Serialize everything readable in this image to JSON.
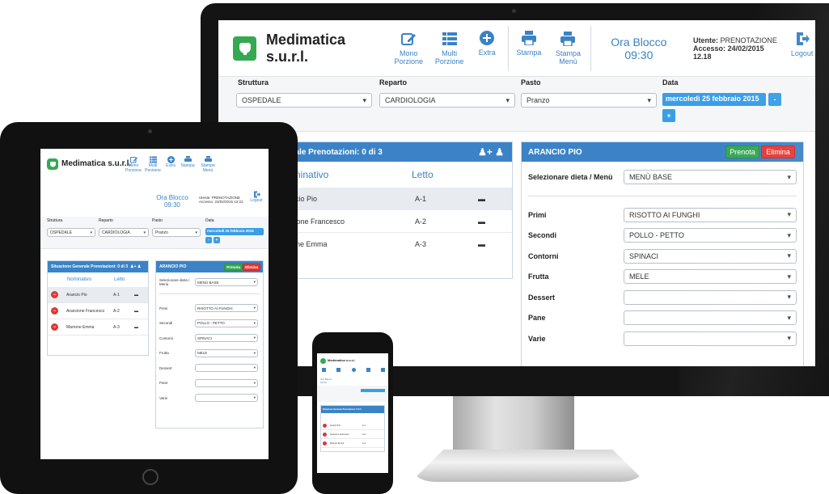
{
  "app": {
    "brand": "Medimatica s.u.r.l.",
    "toolbar": {
      "mono": [
        "Mono",
        "Porzione"
      ],
      "multi": [
        "Multi",
        "Porzione"
      ],
      "extra": "Extra",
      "stampa": "Stampa",
      "stampa_menu": [
        "Stampa",
        "Menù"
      ],
      "logout": "Logout"
    },
    "ora_blocco": {
      "label": "Ora Blocco",
      "value": "09:30"
    },
    "user": {
      "utente_label": "Utente:",
      "utente": "PRENOTAZIONE",
      "accesso_label": "Accesso:",
      "accesso": "24/02/2015 12.18"
    },
    "filters": {
      "struttura": {
        "label": "Struttura",
        "value": "OSPEDALE"
      },
      "reparto": {
        "label": "Reparto",
        "value": "CARDIOLOGIA"
      },
      "pasto": {
        "label": "Pasto",
        "value": "Pranzo"
      },
      "data": {
        "label": "Data",
        "value": "mercoledì 25 febbraio 2015",
        "prev": "-",
        "next": "+"
      }
    },
    "situazione": {
      "title": "Situazione Generale Prenotazioni: 0 di 3",
      "title_partial": "erale Prenotazioni: 0 di 3",
      "col_nominativo": "Nominativo",
      "col_nominativo_partial": "ominativo",
      "col_letto": "Letto",
      "rows": [
        {
          "name": "Arancio Pio",
          "partial": "ancio Pio",
          "bed": "A-1"
        },
        {
          "name": "Arancione Francesco",
          "partial": "ncione Francesco",
          "bed": "A-2"
        },
        {
          "name": "Marrone Emma",
          "partial": "rrone Emma",
          "bed": "A-3"
        }
      ]
    },
    "patient": {
      "name": "ARANCIO PIO",
      "prenota": "Prenota",
      "elimina": "Elimina",
      "dieta_label": "Selezionare dieta / Menù",
      "dieta_value": "MENÙ BASE",
      "courses": [
        {
          "label": "Primi",
          "value": "RISOTTO AI FUNGHI"
        },
        {
          "label": "Secondi",
          "value": "POLLO - PETTO"
        },
        {
          "label": "Contorni",
          "value": "SPINACI"
        },
        {
          "label": "Frutta",
          "value": "MELE"
        },
        {
          "label": "Dessert",
          "value": ""
        },
        {
          "label": "Pane",
          "value": ""
        },
        {
          "label": "Varie",
          "value": ""
        }
      ]
    },
    "tablet_user": {
      "accesso": "24/02/2015 12:23"
    }
  }
}
